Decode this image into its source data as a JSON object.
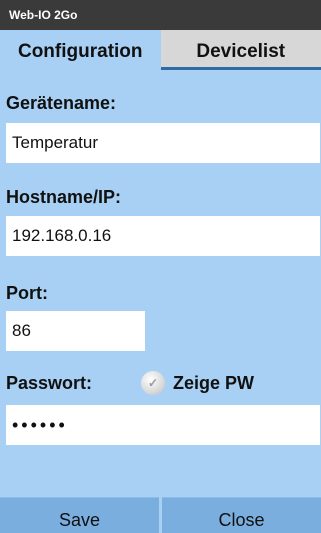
{
  "app": {
    "title": "Web-IO 2Go"
  },
  "tabs": [
    {
      "label": "Configuration",
      "active": true
    },
    {
      "label": "Devicelist",
      "active": false
    }
  ],
  "form": {
    "devicename_label": "Gerätename:",
    "devicename_value": "Temperatur",
    "hostname_label": "Hostname/IP:",
    "hostname_value": "192.168.0.16",
    "port_label": "Port:",
    "port_value": "86",
    "password_label": "Passwort:",
    "password_value": "••••••",
    "show_pw_label": "Zeige PW",
    "show_pw_checked": false
  },
  "buttons": {
    "save_label": "Save",
    "close_label": "Close"
  },
  "colors": {
    "background": "#a8d0f4",
    "titlebar": "#3a3a3a",
    "inactive_tab": "#d7d7d7",
    "tab_underline": "#2e6da4",
    "button": "#7aaedf"
  }
}
